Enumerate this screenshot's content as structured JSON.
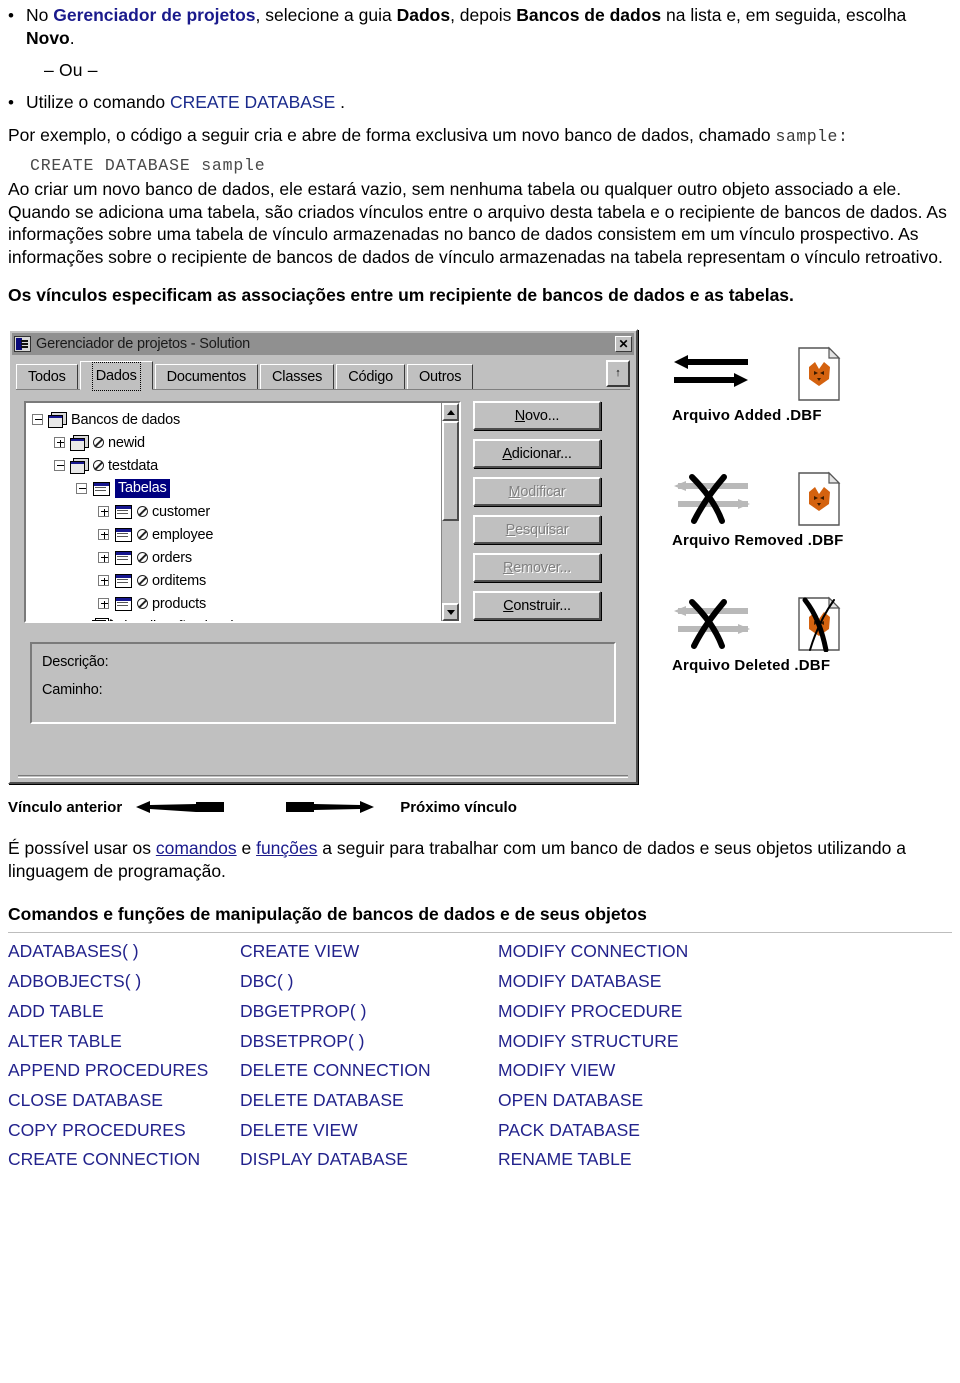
{
  "intro": {
    "bullet1": {
      "pre": "No ",
      "bold_blue": "Gerenciador de projetos",
      "mid1": ", selecione a guia ",
      "bold1": "Dados",
      "mid2": ", depois ",
      "bold2": "Bancos de dados",
      "mid3": " na lista e, em seguida, escolha ",
      "bold3": "Novo",
      "post": "."
    },
    "or_line": "– Ou –",
    "bullet2": {
      "pre": "Utilize o comando ",
      "cmd": "CREATE DATABASE",
      "post": " ."
    },
    "paragraph1": "Por exemplo, o código a seguir cria e abre de forma exclusiva um novo banco de dados, chamado",
    "sample_word": "sample:",
    "code": "CREATE DATABASE sample",
    "paragraph2": "Ao criar um novo banco de dados, ele estará vazio, sem nenhuma tabela ou qualquer outro objeto associado a ele. Quando se adiciona uma tabela, são criados vínculos entre o arquivo desta tabela e o recipiente de bancos de dados. As informações sobre uma tabela de vínculo armazenadas no banco de dados consistem em um vínculo prospectivo. As informações sobre o recipiente de bancos de dados de vínculo armazenadas na tabela representam o vínculo retroativo.",
    "paragraph3": "Os vínculos especificam as associações entre um recipiente de bancos de dados e as tabelas."
  },
  "window": {
    "title": "Gerenciador de projetos - Solution",
    "close_label": "✕",
    "tabs": [
      {
        "label": "Todos",
        "selected": false
      },
      {
        "label": "Dados",
        "selected": true
      },
      {
        "label": "Documentos",
        "selected": false
      },
      {
        "label": "Classes",
        "selected": false
      },
      {
        "label": "Código",
        "selected": false
      },
      {
        "label": "Outros",
        "selected": false
      }
    ],
    "tab_scroll_label": "↑",
    "tree": [
      {
        "label": "Bancos de dados",
        "indent": 0,
        "state": "minus",
        "icon": "database-icon",
        "noentry": false,
        "selected": false
      },
      {
        "label": "newid",
        "indent": 1,
        "state": "plus",
        "icon": "database-icon",
        "noentry": true,
        "selected": false
      },
      {
        "label": "testdata",
        "indent": 1,
        "state": "minus",
        "icon": "database-icon",
        "noentry": true,
        "selected": false
      },
      {
        "label": "Tabelas",
        "indent": 2,
        "state": "minus",
        "icon": "table-icon",
        "noentry": false,
        "selected": true
      },
      {
        "label": "customer",
        "indent": 3,
        "state": "plus",
        "icon": "table-icon",
        "noentry": true,
        "selected": false
      },
      {
        "label": "employee",
        "indent": 3,
        "state": "plus",
        "icon": "table-icon",
        "noentry": true,
        "selected": false
      },
      {
        "label": "orders",
        "indent": 3,
        "state": "plus",
        "icon": "table-icon",
        "noentry": true,
        "selected": false
      },
      {
        "label": "orditems",
        "indent": 3,
        "state": "plus",
        "icon": "table-icon",
        "noentry": true,
        "selected": false
      },
      {
        "label": "products",
        "indent": 3,
        "state": "plus",
        "icon": "table-icon",
        "noentry": true,
        "selected": false
      },
      {
        "label": "Visualizações locais",
        "indent": 2,
        "state": "plus",
        "icon": "views-icon",
        "noentry": false,
        "selected": false
      }
    ],
    "buttons": [
      {
        "accel": "N",
        "rest": "ovo...",
        "enabled": true
      },
      {
        "accel": "A",
        "rest": "dicionar...",
        "enabled": true
      },
      {
        "accel": "M",
        "rest": "odificar",
        "enabled": false
      },
      {
        "accel": "P",
        "rest": "esquisar",
        "enabled": false
      },
      {
        "accel": "R",
        "rest": "emover...",
        "enabled": false
      },
      {
        "accel": "C",
        "rest": "onstruir...",
        "enabled": true
      }
    ],
    "description_label": "Descrição:",
    "path_label": "Caminho:"
  },
  "diagram": {
    "groups": [
      {
        "label": "Arquivo Added .DBF",
        "arrows": "double-arrow-solid",
        "file": "dbf-file-icon"
      },
      {
        "label": "Arquivo Removed .DBF",
        "arrows": "double-arrow-crossed",
        "file": "dbf-file-icon"
      },
      {
        "label": "Arquivo Deleted .DBF",
        "arrows": "double-arrow-crossed",
        "file": "dbf-file-crossed-icon"
      }
    ]
  },
  "legend": {
    "left_label": "Vínculo anterior",
    "right_label": "Próximo vínculo"
  },
  "closing": {
    "pre": "É possível usar os ",
    "link1": "comandos",
    "mid": " e ",
    "link2": "funções",
    "post": " a seguir para trabalhar com um banco de dados e seus objetos utilizando a linguagem de programação.",
    "heading": "Comandos e funções de manipulação de bancos de dados e de seus objetos"
  },
  "commands_table": {
    "rows": [
      [
        "ADATABASES( )",
        "CREATE VIEW",
        "MODIFY CONNECTION"
      ],
      [
        "ADBOBJECTS( )",
        "DBC( )",
        "MODIFY DATABASE"
      ],
      [
        "ADD TABLE",
        "DBGETPROP( )",
        "MODIFY PROCEDURE"
      ],
      [
        "ALTER TABLE",
        "DBSETPROP( )",
        "MODIFY STRUCTURE"
      ],
      [
        "APPEND PROCEDURES",
        "DELETE CONNECTION",
        "MODIFY VIEW"
      ],
      [
        "CLOSE DATABASE",
        "DELETE DATABASE",
        "OPEN DATABASE"
      ],
      [
        "COPY PROCEDURES",
        "DELETE VIEW",
        "PACK DATABASE"
      ],
      [
        "CREATE CONNECTION",
        "DISPLAY DATABASE",
        "RENAME TABLE"
      ]
    ]
  },
  "colors": {
    "link": "#1a1a8c",
    "command_text": "#22228c",
    "selection": "#000080",
    "window_face": "#c0c0c0",
    "titlebar": "#909090",
    "fox_orange": "#d4620f"
  }
}
